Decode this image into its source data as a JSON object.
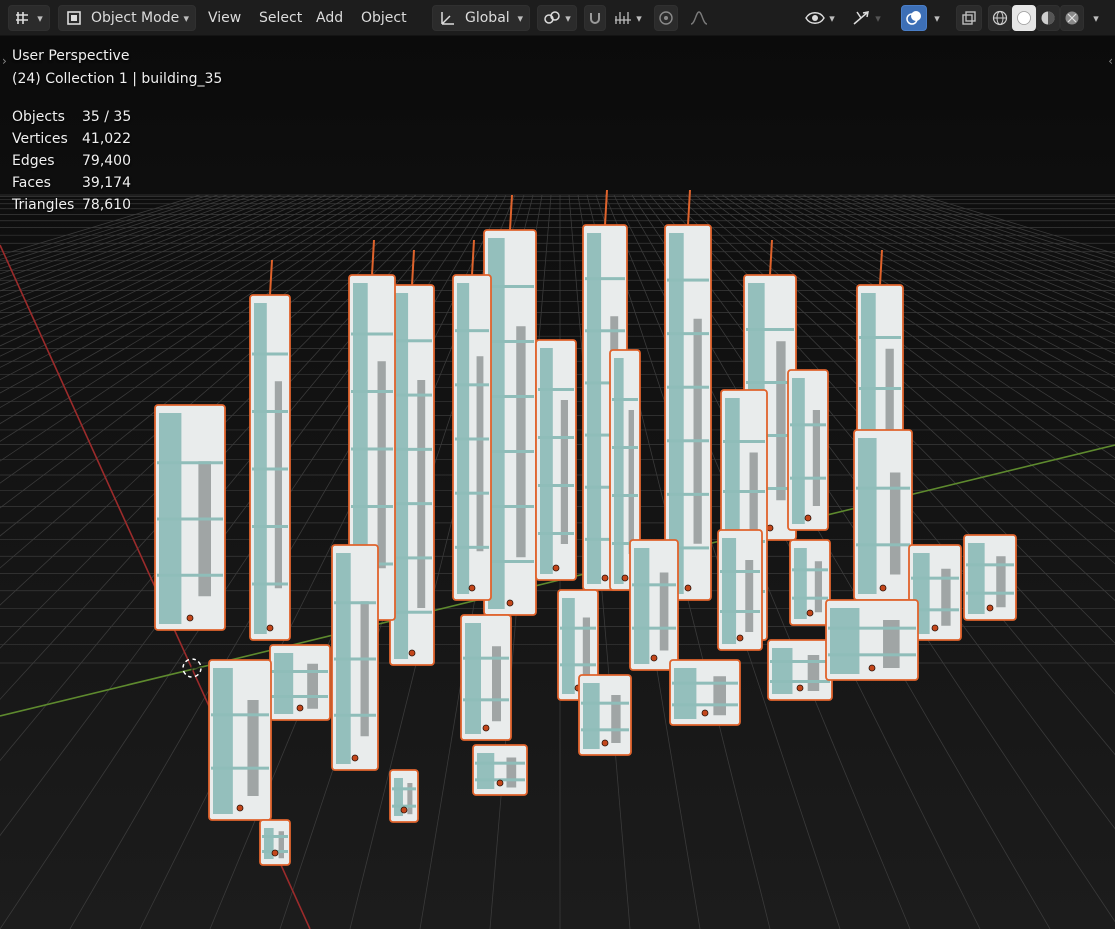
{
  "header": {
    "mode": "Object Mode",
    "menus": [
      "View",
      "Select",
      "Add",
      "Object"
    ],
    "orientation": "Global"
  },
  "viewport": {
    "perspective_label": "User Perspective",
    "collection_label": "(24) Collection 1 | building_35"
  },
  "stats": [
    {
      "label": "Objects",
      "value": "35 / 35"
    },
    {
      "label": "Vertices",
      "value": "41,022"
    },
    {
      "label": "Edges",
      "value": "79,400"
    },
    {
      "label": "Faces",
      "value": "39,174"
    },
    {
      "label": "Triangles",
      "value": "78,610"
    }
  ],
  "colors": {
    "header_bg": "#1d1d1d",
    "viewport_bg": "#0b0b0b",
    "grid": "#3a3a3a",
    "x_axis": "#9b2b2b",
    "y_axis": "#5e8a2e",
    "selection_outline": "#e0632c",
    "building_body": "#e9ecec",
    "building_teal": "#8fbdb9",
    "active_blue": "#3d6fb6"
  },
  "icons": [
    "editor-type-icon",
    "object-mode-icon",
    "transform-orientation-icon",
    "pivot-point-icon",
    "snap-icon",
    "snap-increment-icon",
    "proportional-editing-icon",
    "falloff-icon",
    "visibility-icon",
    "gizmo-icon",
    "overlay-icon",
    "xray-icon",
    "wireframe-shading-icon",
    "solid-shading-icon",
    "material-shading-icon",
    "rendered-shading-icon"
  ]
}
